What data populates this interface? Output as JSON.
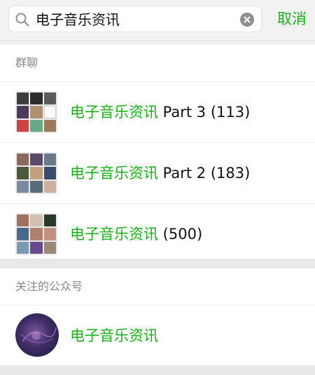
{
  "search": {
    "query": "电子音乐资讯",
    "cancel_label": "取消"
  },
  "groups_section": {
    "header": "群聊",
    "items": [
      {
        "highlight": "电子音乐资讯",
        "suffix": " Part 3 (113)"
      },
      {
        "highlight": "电子音乐资讯",
        "suffix": " Part 2 (183)"
      },
      {
        "highlight": "电子音乐资讯",
        "suffix": " (500)"
      }
    ]
  },
  "official_section": {
    "header": "关注的公众号",
    "items": [
      {
        "highlight": "电子音乐资讯",
        "suffix": ""
      }
    ]
  },
  "colors": {
    "accent": "#1aad19",
    "section_header": "#888888"
  },
  "icons": [
    "search-icon",
    "clear-icon"
  ]
}
